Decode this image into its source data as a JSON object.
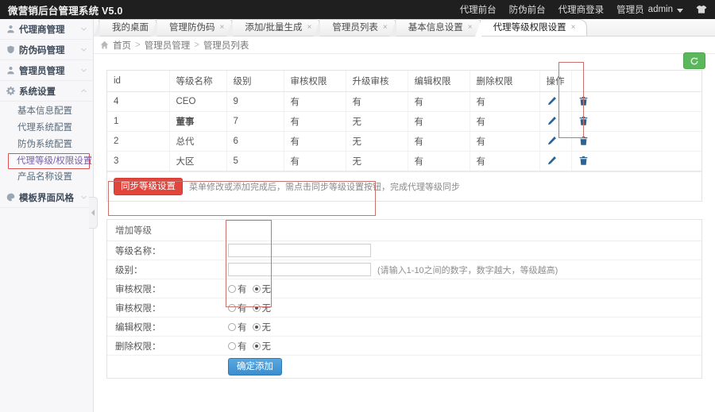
{
  "header": {
    "brand": "微营销后台管理系统 V5.0",
    "links": [
      {
        "label": "代理前台",
        "name": "agent-frontend"
      },
      {
        "label": "防伪前台",
        "name": "anticounterfeit-frontend"
      },
      {
        "label": "代理商登录",
        "name": "agent-login"
      }
    ],
    "user_role": "管理员",
    "user_name": "admin",
    "logout_icon": "shirt-icon"
  },
  "sidebar": {
    "groups": [
      {
        "label": "代理商管理",
        "icon": "user-icon",
        "expanded": false
      },
      {
        "label": "防伪码管理",
        "icon": "shield-icon",
        "expanded": false
      },
      {
        "label": "管理员管理",
        "icon": "admin-icon",
        "expanded": false
      },
      {
        "label": "系统设置",
        "icon": "gear-icon",
        "expanded": true
      }
    ],
    "system_items": [
      {
        "label": "基本信息配置",
        "active": false
      },
      {
        "label": "代理系统配置",
        "active": false
      },
      {
        "label": "防伪系统配置",
        "active": false
      },
      {
        "label": "代理等级/权限设置",
        "active": true
      },
      {
        "label": "产品名称设置",
        "active": false
      }
    ],
    "last_group": {
      "label": "模板界面风格",
      "icon": "palette-icon",
      "expanded": false
    }
  },
  "tabs": [
    {
      "label": "我的桌面",
      "active": false,
      "closable": false
    },
    {
      "label": "管理防伪码",
      "active": false,
      "closable": true
    },
    {
      "label": "添加/批量生成",
      "active": false,
      "closable": true
    },
    {
      "label": "管理员列表",
      "active": false,
      "closable": true
    },
    {
      "label": "基本信息设置",
      "active": false,
      "closable": true
    },
    {
      "label": "代理等级权限设置",
      "active": true,
      "closable": true
    }
  ],
  "breadcrumb": {
    "home_icon": "home-icon",
    "items": [
      "首页",
      "管理员管理",
      "管理员列表"
    ],
    "separator": ">"
  },
  "refresh_button": {
    "icon": "refresh-icon",
    "color": "#5bb75b"
  },
  "table": {
    "columns": [
      "id",
      "等级名称",
      "级别",
      "审核权限",
      "升级审核",
      "编辑权限",
      "删除权限",
      "操作",
      ""
    ],
    "rows": [
      {
        "id": "4",
        "name": "CEO",
        "level": "9",
        "audit": "有",
        "upgrade": "有",
        "edit": "有",
        "delete": "有",
        "bold": false
      },
      {
        "id": "1",
        "name": "董事",
        "level": "7",
        "audit": "有",
        "upgrade": "无",
        "edit": "有",
        "delete": "有",
        "bold": true
      },
      {
        "id": "2",
        "name": "总代",
        "level": "6",
        "audit": "有",
        "upgrade": "无",
        "edit": "有",
        "delete": "有",
        "bold": false
      },
      {
        "id": "3",
        "name": "大区",
        "level": "5",
        "audit": "有",
        "upgrade": "无",
        "edit": "有",
        "delete": "有",
        "bold": false
      }
    ],
    "row_actions": {
      "edit_icon": "pencil-icon",
      "delete_icon": "trash-icon",
      "icon_color": "#2a6496"
    }
  },
  "sync": {
    "button_label": "同步等级设置",
    "button_color": "#e2453c",
    "note": "菜单修改或添加完成后，需点击同步等级设置按钮，完成代理等级同步"
  },
  "add_form": {
    "title": "增加等级",
    "name_label": "等级名称：",
    "name_value": "",
    "level_label": "级别：",
    "level_value": "",
    "level_hint": "(请输入1-10之间的数字，数字越大，等级越高)",
    "radio_rows": [
      {
        "label": "审核权限：",
        "yes": "有",
        "no": "无",
        "selected": "无"
      },
      {
        "label": "审核权限：",
        "yes": "有",
        "no": "无",
        "selected": "无"
      },
      {
        "label": "编辑权限：",
        "yes": "有",
        "no": "无",
        "selected": "无"
      },
      {
        "label": "删除权限：",
        "yes": "有",
        "no": "无",
        "selected": "无"
      }
    ],
    "submit_label": "确定添加",
    "submit_color": "#3c8dcd"
  }
}
